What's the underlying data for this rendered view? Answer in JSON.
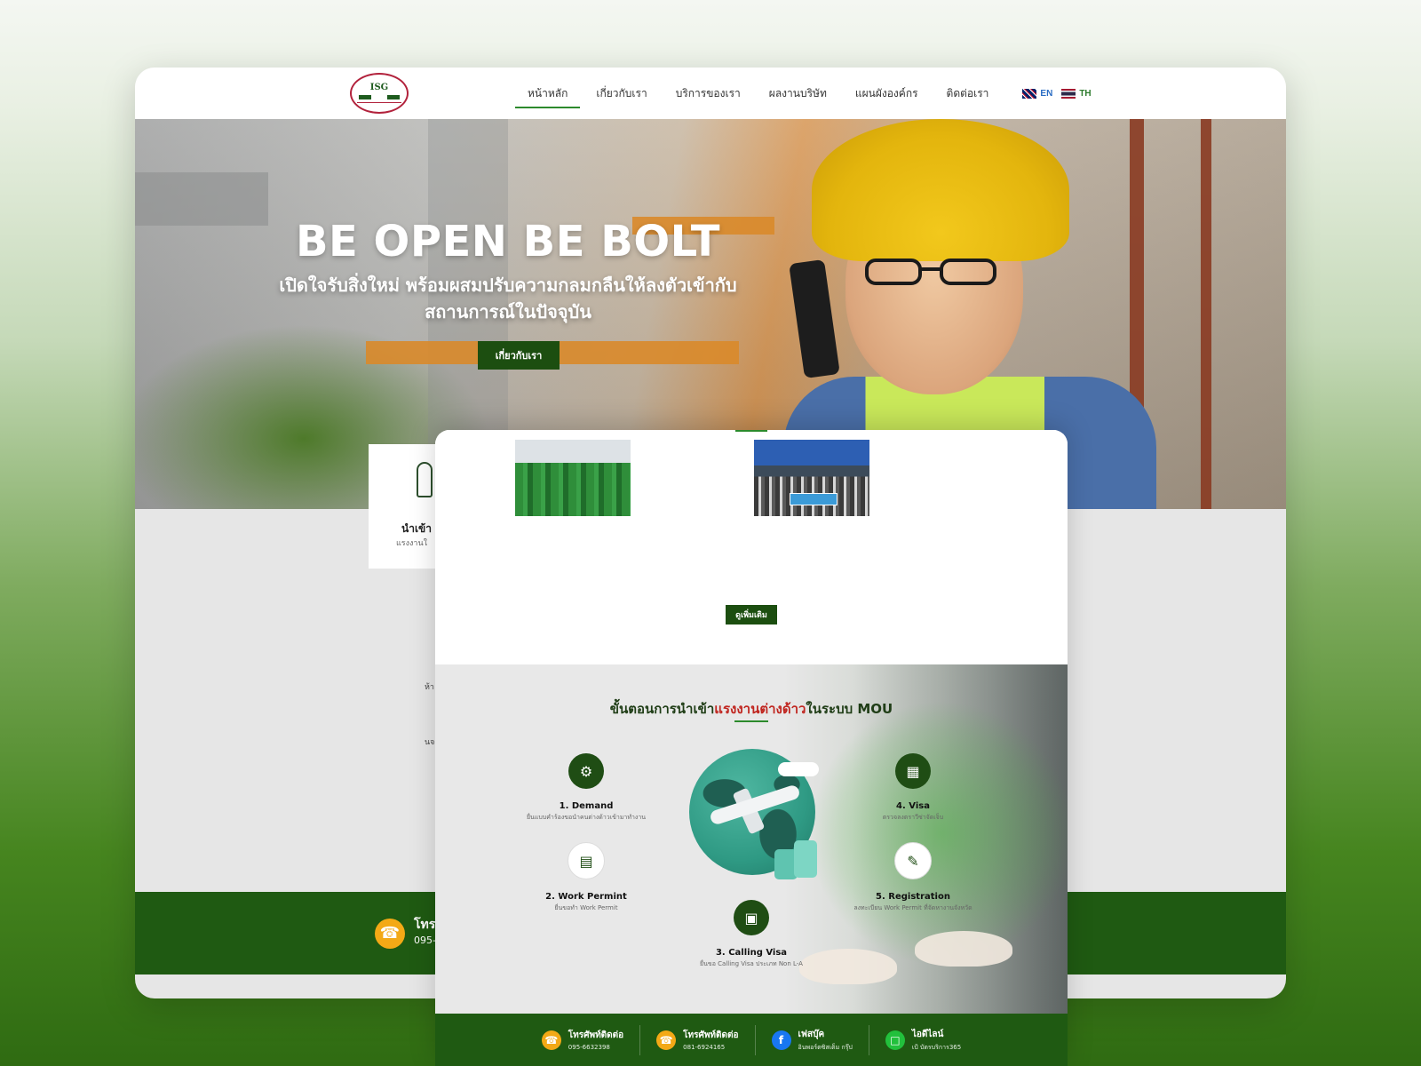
{
  "nav": {
    "logo_text": "ISG",
    "items": [
      "หน้าหลัก",
      "เกี่ยวกับเรา",
      "บริการของเรา",
      "ผลงานบริษัท",
      "แผนผังองค์กร",
      "ติดต่อเรา"
    ],
    "lang_en": "EN",
    "lang_th": "TH"
  },
  "hero": {
    "title": "BE OPEN BE BOLT",
    "subtitle": "เปิดใจรับสิ่งใหม่ พร้อมผสมปรับความกลมกลืนให้ลงตัวเข้ากับสถานการณ์ในปัจจุบัน",
    "button": "เกี่ยวกับเรา"
  },
  "service_card": {
    "title": "นำเข้า",
    "subtitle": "แรงงานใ"
  },
  "back_peek": {
    "line_1": "ห้า",
    "line_2": "นจ"
  },
  "back_footer": {
    "label": "โทร",
    "number": "095-"
  },
  "gallery": {
    "more_button": "ดูเพิ่มเติม"
  },
  "mou": {
    "title_prefix": "ขั้นตอนการนำเข้า",
    "title_highlight": "แรงงานต่างด้าว",
    "title_suffix": "ในระบบ MOU",
    "steps": [
      {
        "title": "1. Demand",
        "desc": "ยื่นแบบคำร้องขอนำคนต่างด้าวเข้ามาทำงาน",
        "icon": "demand-icon"
      },
      {
        "title": "2. Work Permint",
        "desc": "ยื่นขอทำ Work Permit",
        "icon": "document-icon"
      },
      {
        "title": "3. Calling Visa",
        "desc": "ยื่นขอ Calling Visa ประเภท Non L-A",
        "icon": "passport-icon"
      },
      {
        "title": "4. Visa",
        "desc": "ตรวจลงตราวีซ่าจัดเจ็บ",
        "icon": "visa-card-icon"
      },
      {
        "title": "5. Registration",
        "desc": "ลงทะเบียน Work Permit ที่จัดหางานจังหวัด",
        "icon": "clipboard-icon"
      }
    ]
  },
  "footer": {
    "contacts": [
      {
        "label": "โทรศัพท์ติดต่อ",
        "value": "095-6632398",
        "icon": "phone-icon"
      },
      {
        "label": "โทรศัพท์ติดต่อ",
        "value": "081-6924165",
        "icon": "phone-icon"
      },
      {
        "label": "เฟสบุ๊ค",
        "value": "อินพอร์ตซิสเต็ม กรุ๊ป",
        "icon": "facebook-icon"
      },
      {
        "label": "ไอดีไลน์",
        "value": "เป้ บัตรบริการ365",
        "icon": "line-icon"
      }
    ]
  },
  "colors": {
    "brand_green": "#1f5a12",
    "accent_green": "#2c8a2c",
    "highlight_red": "#c0251f",
    "phone_orange": "#f3a916"
  }
}
